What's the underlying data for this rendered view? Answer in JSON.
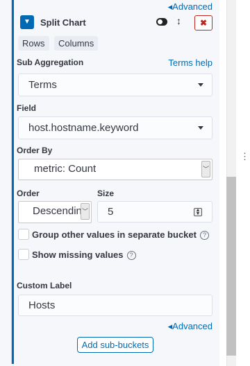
{
  "header": {
    "advanced_top": "◂Advanced",
    "title": "Split Chart",
    "remove_label": "✖"
  },
  "tabs": [
    "Rows",
    "Columns"
  ],
  "sub_aggregation": {
    "label": "Sub Aggregation",
    "help": "Terms help",
    "value": "Terms"
  },
  "field": {
    "label": "Field",
    "value": "host.hostname.keyword"
  },
  "order_by": {
    "label": "Order By",
    "value": "metric: Count"
  },
  "order": {
    "label": "Order",
    "value": "Descendin"
  },
  "size": {
    "label": "Size",
    "value": "5"
  },
  "checks": [
    {
      "label": "Group other values in separate bucket",
      "checked": false
    },
    {
      "label": "Show missing values",
      "checked": false
    }
  ],
  "custom_label": {
    "label": "Custom Label",
    "value": "Hosts"
  },
  "advanced_bottom": "◂Advanced",
  "add_button": "Add sub-buckets",
  "icons": {
    "help": "?",
    "native_arrow": "﹀"
  }
}
